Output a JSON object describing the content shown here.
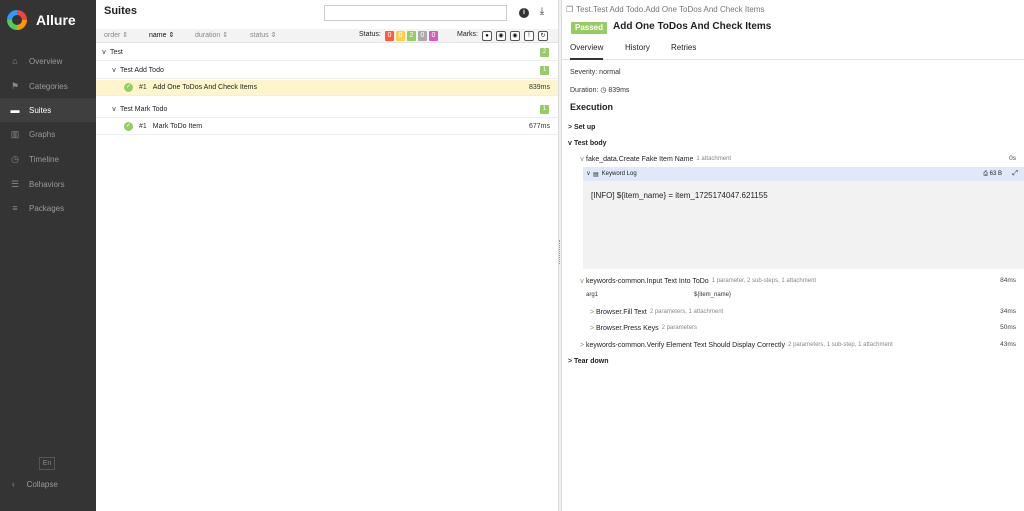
{
  "brand": {
    "name": "Allure"
  },
  "sidebar": {
    "items": [
      {
        "label": "Overview",
        "icon": "home-icon"
      },
      {
        "label": "Categories",
        "icon": "flag-icon"
      },
      {
        "label": "Suites",
        "icon": "briefcase-icon"
      },
      {
        "label": "Graphs",
        "icon": "bar-chart-icon"
      },
      {
        "label": "Timeline",
        "icon": "clock-icon"
      },
      {
        "label": "Behaviors",
        "icon": "list-icon"
      },
      {
        "label": "Packages",
        "icon": "align-left-icon"
      }
    ],
    "active": "Suites",
    "language": "En",
    "collapse_label": "Collapse"
  },
  "suites": {
    "title": "Suites",
    "search": {
      "value": "",
      "placeholder": ""
    },
    "sort": {
      "order": "order",
      "name": "name",
      "duration": "duration",
      "status": "status"
    },
    "status_label": "Status:",
    "status_counts": [
      {
        "value": "0",
        "color": "#fd5a3e"
      },
      {
        "value": "0",
        "color": "#ffd050"
      },
      {
        "value": "2",
        "color": "#97cc64"
      },
      {
        "value": "0",
        "color": "#aaaaaa"
      },
      {
        "value": "0",
        "color": "#d35ebe"
      }
    ],
    "marks_label": "Marks:",
    "tree": {
      "root": {
        "label": "Test",
        "count": "2"
      },
      "groups": [
        {
          "label": "Test Add Todo",
          "count": "1",
          "cases": [
            {
              "num": "#1",
              "name": "Add One ToDos And Check Items",
              "duration": "839ms"
            }
          ]
        },
        {
          "label": "Test Mark Todo",
          "count": "1",
          "cases": [
            {
              "num": "#1",
              "name": "Mark ToDo Item",
              "duration": "677ms"
            }
          ]
        }
      ]
    }
  },
  "result": {
    "breadcrumb": "Test.Test Add Todo.Add One ToDos And Check Items",
    "status": "Passed",
    "title": "Add One ToDos And Check Items",
    "tabs": [
      "Overview",
      "History",
      "Retries"
    ],
    "severity": "Severity: normal",
    "duration": "Duration: ◷ 839ms",
    "execution_title": "Execution",
    "setup": "Set up",
    "test_body": "Test body",
    "steps": [
      {
        "name": "fake_data.Create Fake Item Name",
        "sub": "1 attachment",
        "time": "0s"
      },
      {
        "name": "keywords-common.Input Text Into ToDo",
        "sub": "1 parameter, 2 sub-steps, 1 attachment",
        "time": "84ms"
      },
      {
        "name": "Browser.Fill Text",
        "sub": "2 parameters, 1 attachment",
        "time": "34ms"
      },
      {
        "name": "Browser.Press Keys",
        "sub": "2 parameters",
        "time": "50ms"
      },
      {
        "name": "keywords-common.Verify Element Text Should Display Correctly",
        "sub": "2 parameters, 1 sub-step, 1 attachment",
        "time": "43ms"
      }
    ],
    "attachment": {
      "name": "Keyword Log",
      "size": "63 B",
      "content": "[INFO] ${item_name} = item_1725174047.621155"
    },
    "param": {
      "name": "arg1",
      "value": "${item_name}"
    },
    "teardown": "Tear down"
  }
}
